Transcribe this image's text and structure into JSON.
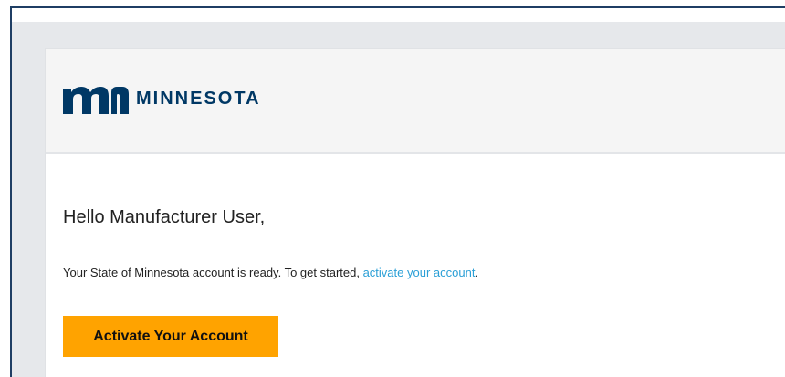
{
  "header": {
    "logo_icon": "minnesota-mn-logo-icon",
    "logo_text": "MINNESOTA"
  },
  "email": {
    "greeting": "Hello Manufacturer User,",
    "message_prefix": "Your State of Minnesota account is ready. To get started, ",
    "link_text": "activate your account",
    "message_suffix": ".",
    "button_label": "Activate Your Account"
  },
  "colors": {
    "brand_navy": "#003865",
    "button_orange": "#ffa300",
    "link_blue": "#2a9fd6",
    "page_gray": "#e6e8eb",
    "header_gray": "#f5f5f5"
  }
}
